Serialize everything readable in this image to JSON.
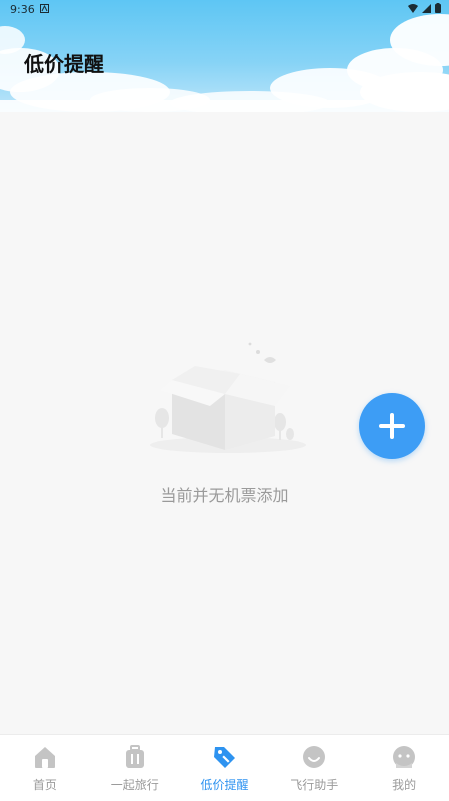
{
  "status_bar": {
    "time": "9:36"
  },
  "header": {
    "title": "低价提醒"
  },
  "empty_state": {
    "message": "当前并无机票添加"
  },
  "fab": {
    "icon": "plus-icon"
  },
  "tabs": [
    {
      "label": "首页",
      "icon": "home-icon",
      "active": false
    },
    {
      "label": "一起旅行",
      "icon": "luggage-icon",
      "active": false
    },
    {
      "label": "低价提醒",
      "icon": "price-tag-icon",
      "active": true
    },
    {
      "label": "飞行助手",
      "icon": "smile-face-icon",
      "active": false
    },
    {
      "label": "我的",
      "icon": "profile-face-icon",
      "active": false
    }
  ],
  "colors": {
    "accent": "#3d9df5",
    "active_tab": "#2e93f0",
    "inactive_tab": "#bcbcbc"
  }
}
